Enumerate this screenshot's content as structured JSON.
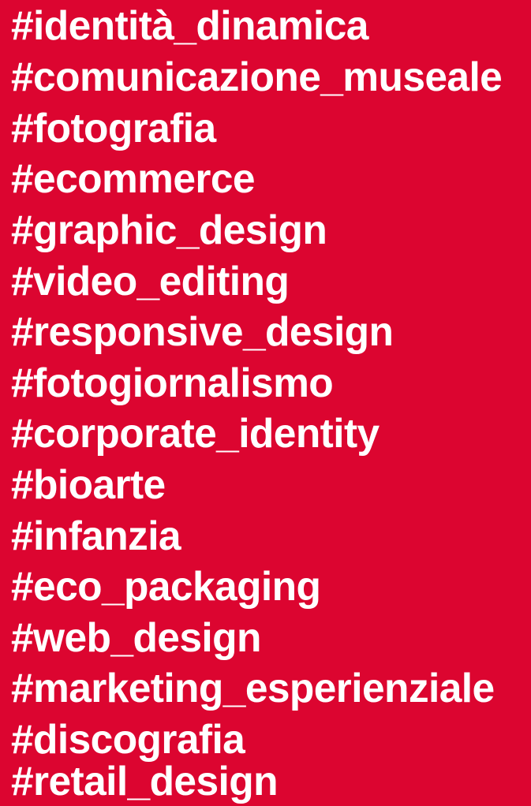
{
  "background_color": "#dc0530",
  "text_color": "#ffffff",
  "tags": [
    {
      "label": "#identità_dinamica"
    },
    {
      "label": "#comunicazione_museale"
    },
    {
      "label": "#fotografia"
    },
    {
      "label": "#ecommerce"
    },
    {
      "label": "#graphic_design"
    },
    {
      "label": "#video_editing"
    },
    {
      "label": "#responsive_design"
    },
    {
      "label": "#fotogiornalismo"
    },
    {
      "label": "#corporate_identity"
    },
    {
      "label": "#bioarte"
    },
    {
      "label": "#infanzia"
    },
    {
      "label": "#eco_packaging"
    },
    {
      "label": "#web_design"
    },
    {
      "label": "#marketing_esperienziale"
    },
    {
      "label": "#discografia"
    },
    {
      "label": "#retail_design"
    }
  ]
}
